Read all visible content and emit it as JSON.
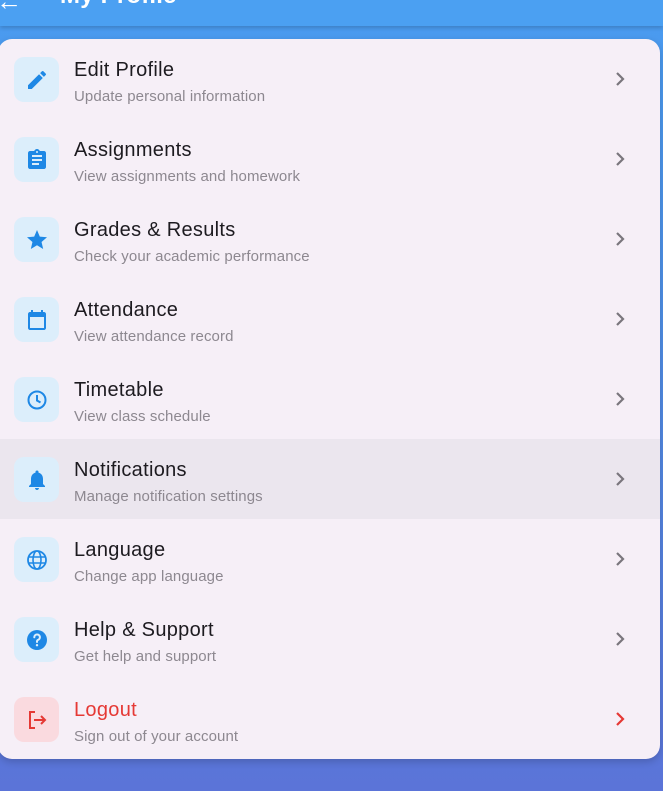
{
  "appbar": {
    "title": "My Profile",
    "back_icon": "arrow-back-icon"
  },
  "colors": {
    "accent": "#1e88e5",
    "danger": "#e53935",
    "icon_bg": "#dceefb",
    "danger_bg": "#fadadf"
  },
  "menu": [
    {
      "label": "Edit Profile",
      "subtitle": "Update personal information",
      "icon": "edit-icon"
    },
    {
      "label": "Assignments",
      "subtitle": "View assignments and homework",
      "icon": "assignment-icon"
    },
    {
      "label": "Grades & Results",
      "subtitle": "Check your academic performance",
      "icon": "star-icon"
    },
    {
      "label": "Attendance",
      "subtitle": "View attendance record",
      "icon": "calendar-icon"
    },
    {
      "label": "Timetable",
      "subtitle": "View class schedule",
      "icon": "clock-icon"
    },
    {
      "label": "Notifications",
      "subtitle": "Manage notification settings",
      "icon": "bell-icon"
    },
    {
      "label": "Language",
      "subtitle": "Change app language",
      "icon": "globe-icon"
    },
    {
      "label": "Help & Support",
      "subtitle": "Get help and support",
      "icon": "help-icon"
    },
    {
      "label": "Logout",
      "subtitle": "Sign out of your account",
      "icon": "logout-icon"
    }
  ]
}
